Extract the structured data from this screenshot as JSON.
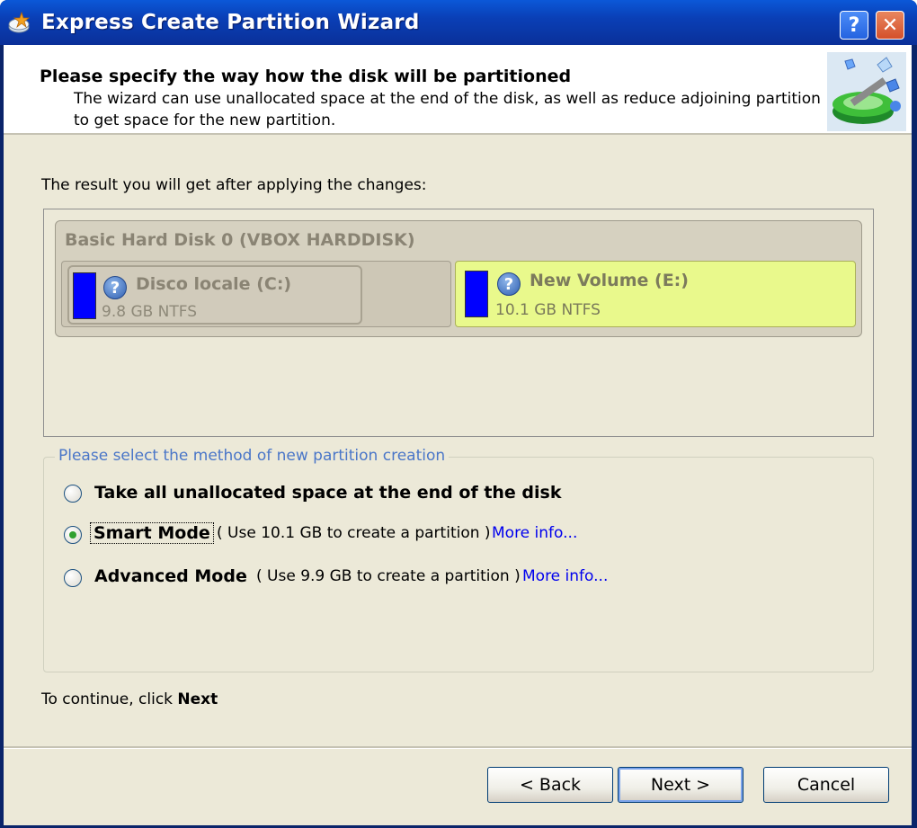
{
  "window": {
    "title": "Express Create Partition Wizard",
    "help_glyph": "?",
    "close_glyph": "✕"
  },
  "header": {
    "title": "Please specify the way how the disk will be partitioned",
    "description": "The wizard can use unallocated space at the end of the disk, as well as reduce adjoining partition to get space for the new partition."
  },
  "result": {
    "label": "The result you will get after applying the changes:",
    "disk_title": "Basic Hard Disk 0 (VBOX HARDDISK)",
    "partitions": [
      {
        "name": "Disco locale (C:)",
        "size": "9.8 GB NTFS",
        "fill_color": "#0000ff"
      },
      {
        "name": "New Volume (E:)",
        "size": "10.1 GB NTFS",
        "fill_color": "#0000ff",
        "highlight_color": "#e9f98c"
      }
    ]
  },
  "method": {
    "legend": "Please select the method of new partition creation",
    "options": [
      {
        "label": "Take all unallocated space at the end of the disk",
        "desc": "",
        "link": "",
        "checked": false
      },
      {
        "label": "Smart Mode",
        "desc": "( Use 10.1 GB to create a partition )",
        "link": "More info...",
        "checked": true
      },
      {
        "label": "Advanced Mode",
        "desc": "( Use 9.9 GB to create a partition )",
        "link": "More info...",
        "checked": false
      }
    ]
  },
  "footer": {
    "continue_prefix": "To continue, click ",
    "continue_bold": "Next",
    "back_label": "< Back",
    "next_label": "Next >",
    "cancel_label": "Cancel"
  }
}
